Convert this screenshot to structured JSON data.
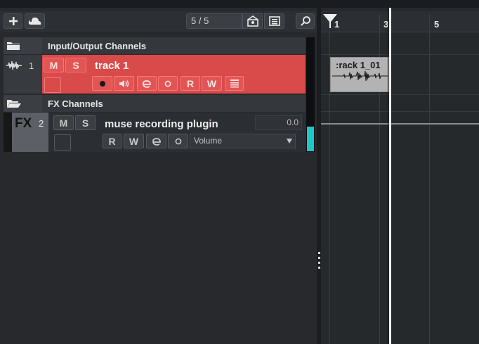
{
  "toolbar": {
    "add_icon": "plus-icon",
    "add_from_cloud_icon": "cloud-plus-icon",
    "track_count": "5 / 5",
    "visibility_icon": "visibility-agent-icon",
    "list_icon": "list-icon",
    "search_icon": "search-icon"
  },
  "folders": [
    {
      "title": "Input/Output Channels",
      "icon": "folder-icon"
    },
    {
      "title": "FX Channels",
      "icon": "folder-open-icon"
    }
  ],
  "tracks": [
    {
      "number": "1",
      "name": "track 1",
      "type_icon": "waveform-icon",
      "mute": "M",
      "solo": "S",
      "read": "R",
      "write": "W",
      "color": "#d94a4a"
    },
    {
      "number": "2",
      "type_label": "FX",
      "name": "muse recording plugin",
      "mute": "M",
      "solo": "S",
      "read": "R",
      "write": "W",
      "value": "0.0",
      "automation_param": "Volume"
    }
  ],
  "ruler": {
    "bars": [
      "1",
      "3",
      "5"
    ]
  },
  "events": [
    {
      "title": ":rack 1_01"
    }
  ]
}
